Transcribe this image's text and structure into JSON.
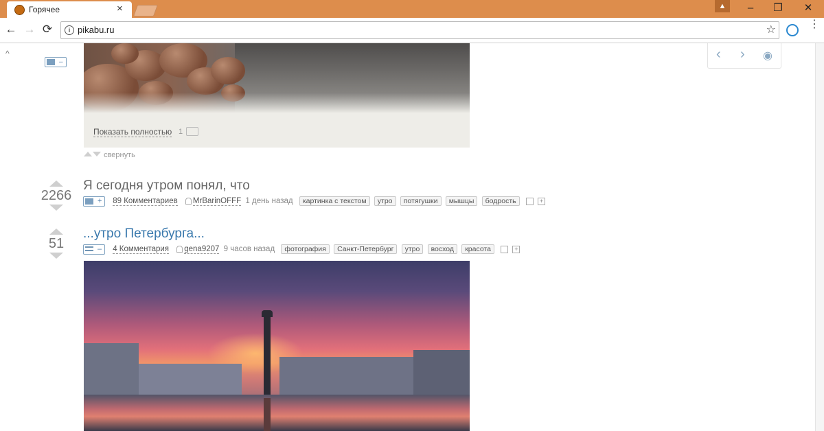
{
  "browser": {
    "tab_title": "Горячее",
    "tab_close": "×",
    "url": "pikabu.ru",
    "win_minimize": "–",
    "win_restore": "❐",
    "win_close": "✕",
    "profile": "▲",
    "nav_back": "←",
    "nav_forward": "→",
    "nav_reload": "⟳",
    "info": "i",
    "star": "☆",
    "menu": "⋮"
  },
  "page": {
    "scroll_up": "^",
    "top_story_type": {
      "icon": "camera-icon",
      "sign": "–"
    },
    "expand": {
      "label": "Показать полностью",
      "count": "1"
    },
    "collapse_label": "свернуть",
    "float_nav": {
      "prev": "‹",
      "next": "›",
      "eye": "◉"
    },
    "stories": [
      {
        "rating": "2266",
        "title": "Я сегодня утром понял, что",
        "title_color": "#666666",
        "type_sign": "+",
        "comments": "89 Комментариев",
        "author": "MrBarinOFFF",
        "time": "1 день назад",
        "tags": [
          "картинка с текстом",
          "утро",
          "потягушки",
          "мышцы",
          "бодрость"
        ]
      },
      {
        "rating": "51",
        "title": "...утро Петербурга...",
        "title_color": "#3a79ad",
        "type_sign": "–",
        "comments": "4 Комментария",
        "author": "gena9207",
        "time": "9 часов назад",
        "tags": [
          "фотография",
          "Санкт-Петербург",
          "утро",
          "восход",
          "красота"
        ]
      }
    ]
  }
}
